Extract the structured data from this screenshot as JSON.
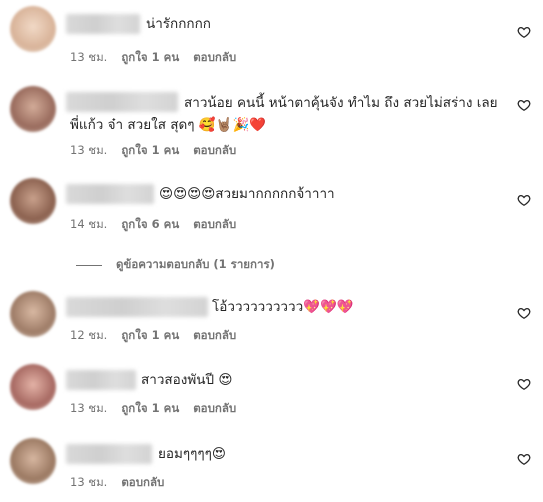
{
  "comments": [
    {
      "text": "น่ารักกกกก",
      "emoji": "",
      "time": "13 ชม.",
      "likes": "ถูกใจ 1 คน",
      "reply": "ตอบกลับ",
      "avatar_color": "#e8c9b4"
    },
    {
      "text": "สาวน้อย คนนี้ หน้าตาคุ้นจัง ทำไม ถึง สวยไม่สร่าง เลย พี่แก้ว จ๋า สวยใส สุดๆ",
      "emoji": "🥰🤘🏽🎉❤️",
      "time": "13 ชม.",
      "likes": "ถูกใจ 1 คน",
      "reply": "ตอบกลับ",
      "avatar_color": "#b58a78"
    },
    {
      "text": "สวยมากกกกกจ้าาาา",
      "emoji": "😍😍😍😍",
      "time": "14 ชม.",
      "likes": "ถูกใจ 6 คน",
      "reply": "ตอบกลับ",
      "avatar_color": "#a67b66"
    },
    {
      "text": "โอ้วววววววววว",
      "emoji": "💖💖💖",
      "time": "12 ชม.",
      "likes": "ถูกใจ 1 คน",
      "reply": "ตอบกลับ",
      "avatar_color": "#b89580"
    },
    {
      "text": "สาวสองพันปี",
      "emoji": "😍",
      "time": "13 ชม.",
      "likes": "ถูกใจ 1 คน",
      "reply": "ตอบกลับ",
      "avatar_color": "#c9918a"
    },
    {
      "text": "ยอมๆๆๆๆ",
      "emoji": "😍",
      "time": "13 ชม.",
      "likes": "",
      "reply": "ตอบกลับ",
      "avatar_color": "#b8977e"
    }
  ],
  "view_replies": "ดูข้อความตอบกลับ (1 รายการ)"
}
